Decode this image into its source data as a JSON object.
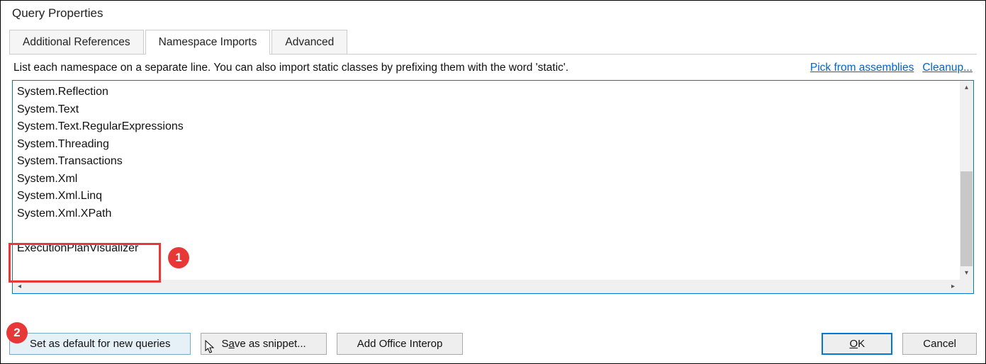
{
  "window": {
    "title": "Query Properties"
  },
  "tabs": [
    {
      "label": "Additional References",
      "active": false
    },
    {
      "label": "Namespace Imports",
      "active": true
    },
    {
      "label": "Advanced",
      "active": false
    }
  ],
  "instruction": "List each namespace on a separate line. You can also import static classes by prefixing them with the word 'static'.",
  "links": {
    "pick": "Pick from assemblies",
    "cleanup": "Cleanup..."
  },
  "namespaces": [
    "System.Reflection",
    "System.Text",
    "System.Text.RegularExpressions",
    "System.Threading",
    "System.Transactions",
    "System.Xml",
    "System.Xml.Linq",
    "System.Xml.XPath",
    "",
    "ExecutionPlanVisualizer"
  ],
  "buttons": {
    "setDefault": "Set as default for new queries",
    "saveSnippet_pre": "S",
    "saveSnippet_u": "a",
    "saveSnippet_post": "ve as snippet...",
    "addOffice": "Add Office Interop",
    "ok_u": "O",
    "ok_post": "K",
    "cancel": "Cancel"
  },
  "callouts": {
    "one": "1",
    "two": "2"
  }
}
